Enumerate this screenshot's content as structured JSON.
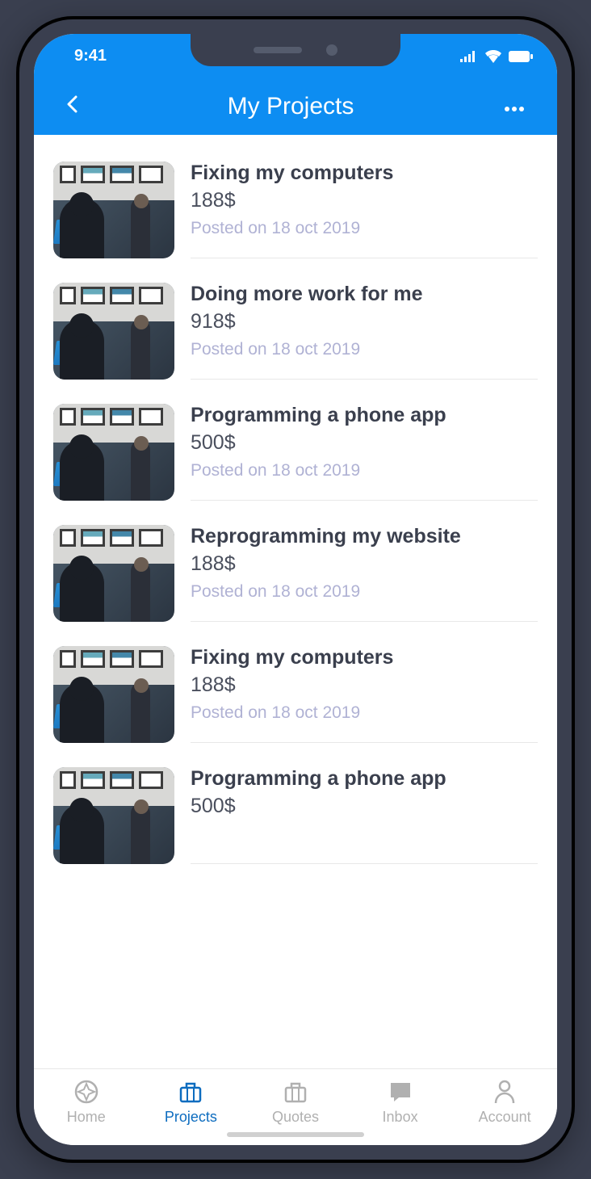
{
  "status": {
    "time": "9:41"
  },
  "header": {
    "title": "My Projects"
  },
  "projects": [
    {
      "title": "Fixing my computers",
      "price": "188$",
      "date": "Posted on 18 oct 2019"
    },
    {
      "title": "Doing more work for me",
      "price": "918$",
      "date": "Posted on 18 oct 2019"
    },
    {
      "title": "Programming a phone app",
      "price": "500$",
      "date": "Posted on 18 oct 2019"
    },
    {
      "title": "Reprogramming my website",
      "price": "188$",
      "date": "Posted on 18 oct 2019"
    },
    {
      "title": "Fixing my computers",
      "price": "188$",
      "date": "Posted on 18 oct 2019"
    },
    {
      "title": "Programming a phone app",
      "price": "500$",
      "date": ""
    }
  ],
  "tabs": [
    {
      "label": "Home",
      "icon": "compass",
      "active": false
    },
    {
      "label": "Projects",
      "icon": "briefcase",
      "active": true
    },
    {
      "label": "Quotes",
      "icon": "briefcase",
      "active": false
    },
    {
      "label": "Inbox",
      "icon": "chat",
      "active": false
    },
    {
      "label": "Account",
      "icon": "person",
      "active": false
    }
  ]
}
